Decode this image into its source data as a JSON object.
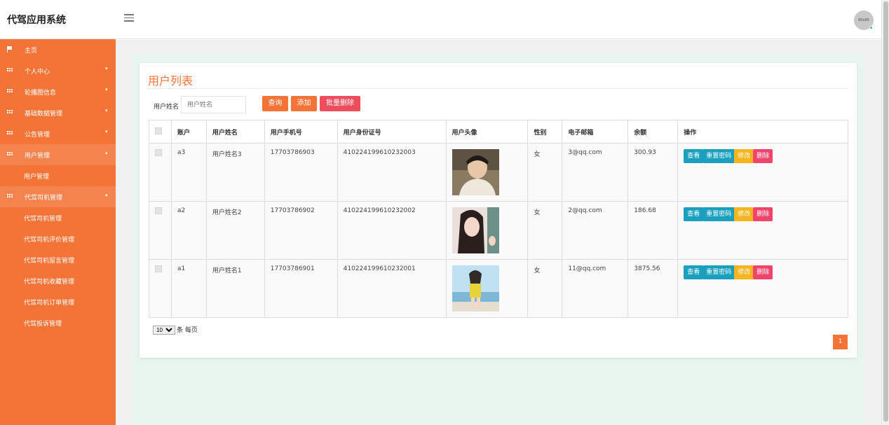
{
  "app": {
    "title": "代驾应用系统",
    "avatar_text": "80x80"
  },
  "sidebar": {
    "items": [
      {
        "label": "主页",
        "icon": "flag-icon"
      },
      {
        "label": "个人中心",
        "icon": "grid-icon",
        "caret": "▾"
      },
      {
        "label": "轮播图信息",
        "icon": "grid-icon",
        "caret": "▾"
      },
      {
        "label": "基础数据管理",
        "icon": "grid-icon",
        "caret": "▾"
      },
      {
        "label": "公告管理",
        "icon": "grid-icon",
        "caret": "▾"
      },
      {
        "label": "用户管理",
        "icon": "grid-icon",
        "caret": "▴",
        "children": [
          "用户管理"
        ]
      },
      {
        "label": "代驾司机管理",
        "icon": "grid-icon",
        "caret": "▴",
        "children": [
          "代驾司机管理",
          "代驾司机评价管理",
          "代驾司机留言管理",
          "代驾司机收藏管理",
          "代驾司机订单管理",
          "代驾投诉管理"
        ]
      }
    ]
  },
  "page": {
    "title": "用户列表",
    "search": {
      "label": "用户姓名",
      "placeholder": "用户姓名"
    },
    "buttons": {
      "query": "查询",
      "add": "添加",
      "batch_delete": "批量删除"
    },
    "table": {
      "headers": [
        "账户",
        "用户姓名",
        "用户手机号",
        "用户身份证号",
        "用户头像",
        "性别",
        "电子邮箱",
        "余额",
        "操作"
      ],
      "rows": [
        {
          "account": "a3",
          "name": "用户姓名3",
          "phone": "17703786903",
          "id_card": "410224199610232003",
          "gender": "女",
          "email": "3@qq.com",
          "balance": "300.93"
        },
        {
          "account": "a2",
          "name": "用户姓名2",
          "phone": "17703786902",
          "id_card": "410224199610232002",
          "gender": "女",
          "email": "2@qq.com",
          "balance": "186.68"
        },
        {
          "account": "a1",
          "name": "用户姓名1",
          "phone": "17703786901",
          "id_card": "410224199610232001",
          "gender": "女",
          "email": "11@qq.com",
          "balance": "3875.56"
        }
      ],
      "actions": {
        "view": "查看",
        "reset_password": "重置密码",
        "edit": "修改",
        "delete": "删除"
      }
    },
    "pagination": {
      "page_size": "10",
      "per_page_text": "条 每页",
      "current_page": "1"
    }
  }
}
